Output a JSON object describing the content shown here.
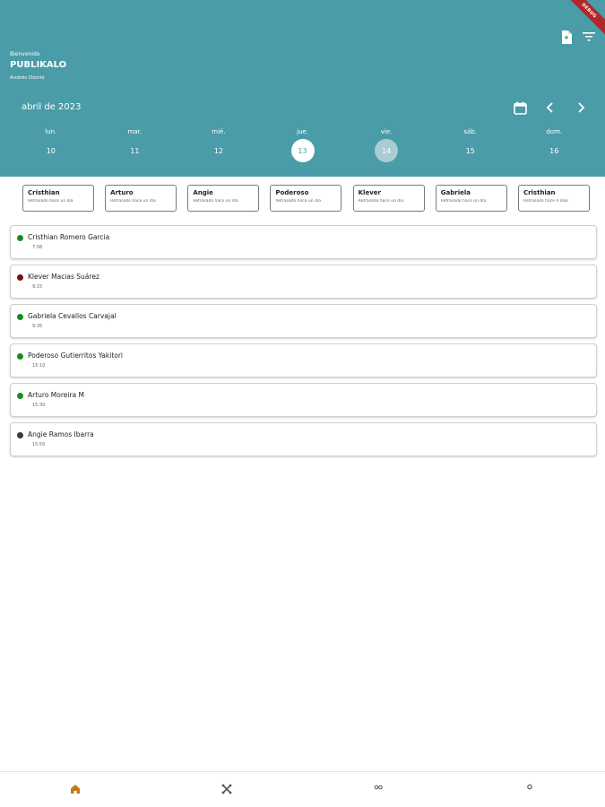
{
  "header": {
    "debug_label": "DEBUG",
    "welcome": "Bienvenido",
    "title": "PUBLIKALO",
    "user": "Andrés Ozorio",
    "month": "abril de 2023",
    "color": "#4a9ca8"
  },
  "week": [
    {
      "name": "lun.",
      "num": "10",
      "state": "normal"
    },
    {
      "name": "mar.",
      "num": "11",
      "state": "normal"
    },
    {
      "name": "mié.",
      "num": "12",
      "state": "normal"
    },
    {
      "name": "jue.",
      "num": "13",
      "state": "today"
    },
    {
      "name": "vie.",
      "num": "14",
      "state": "selected"
    },
    {
      "name": "sáb.",
      "num": "15",
      "state": "normal"
    },
    {
      "name": "dom.",
      "num": "16",
      "state": "normal"
    }
  ],
  "chips": [
    {
      "name": "Cristhian",
      "sub": "Retrasado hace un día"
    },
    {
      "name": "Arturo",
      "sub": "Retrasado hace un día"
    },
    {
      "name": "Angie",
      "sub": "Retrasado hace un día"
    },
    {
      "name": "Poderoso",
      "sub": "Retrasado hace un día"
    },
    {
      "name": "Klever",
      "sub": "Retrasado hace un día"
    },
    {
      "name": "Gabriela",
      "sub": "Retrasado hace un día"
    },
    {
      "name": "Cristhian",
      "sub": "Retrasado hace 4 días"
    }
  ],
  "appointments": [
    {
      "name": "Cristhian Romero Garcia",
      "time": "7:58",
      "color": "#1e8a1e"
    },
    {
      "name": "Klever Macias Suárez",
      "time": "9:15",
      "color": "#7a1010"
    },
    {
      "name": "Gabriela Cevallos Carvajal",
      "time": "9:35",
      "color": "#1e8a1e"
    },
    {
      "name": "Poderoso Gutierritos Yakitori",
      "time": "15:10",
      "color": "#1e8a1e"
    },
    {
      "name": "Arturo Moreira M",
      "time": "15:30",
      "color": "#1e8a1e"
    },
    {
      "name": "Angie Ramos Ibarra",
      "time": "15:50",
      "color": "#3a3a3a"
    }
  ],
  "nav": {
    "items": [
      {
        "icon": "home-icon",
        "active": true
      },
      {
        "icon": "tools-icon",
        "active": false
      },
      {
        "icon": "group-icon",
        "active": false
      },
      {
        "icon": "person-icon",
        "active": false
      }
    ],
    "active_color": "#c27a1a",
    "inactive_color": "#555555"
  }
}
